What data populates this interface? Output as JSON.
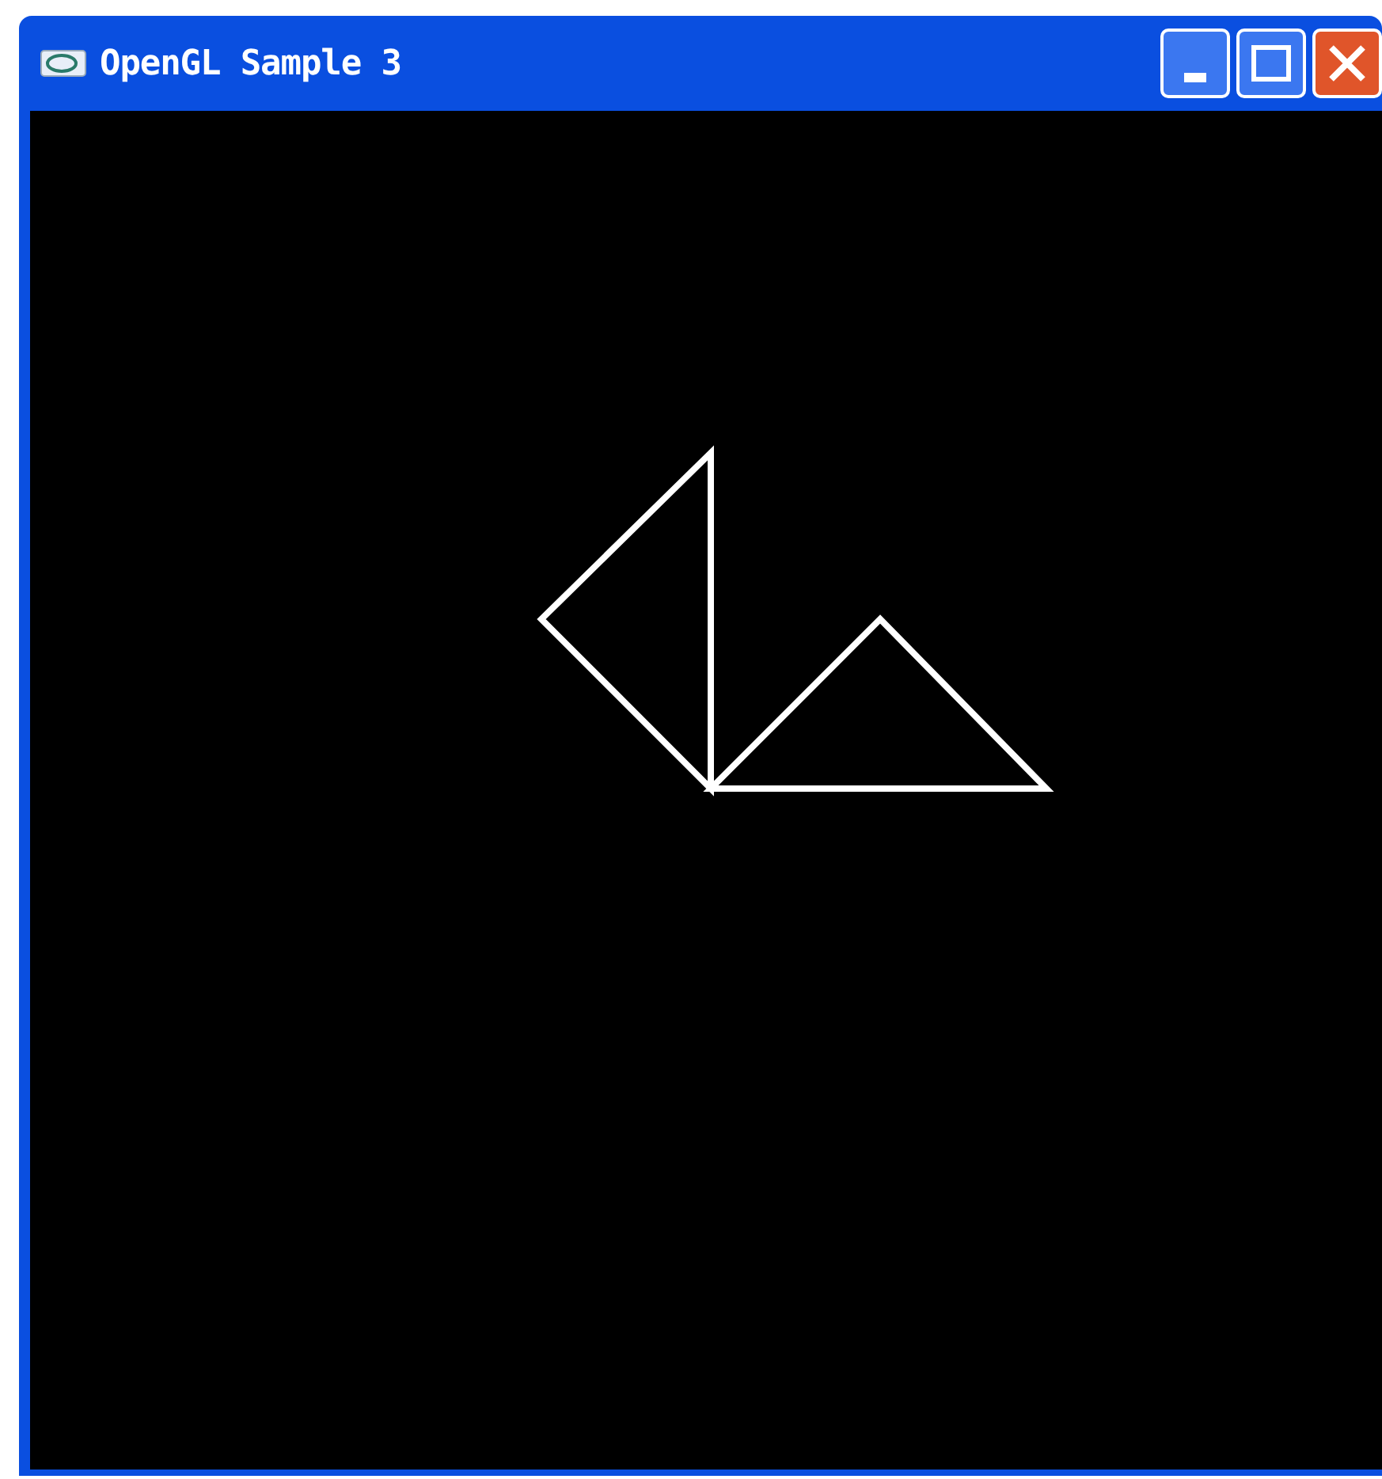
{
  "window": {
    "title": "OpenGL Sample 3"
  }
}
